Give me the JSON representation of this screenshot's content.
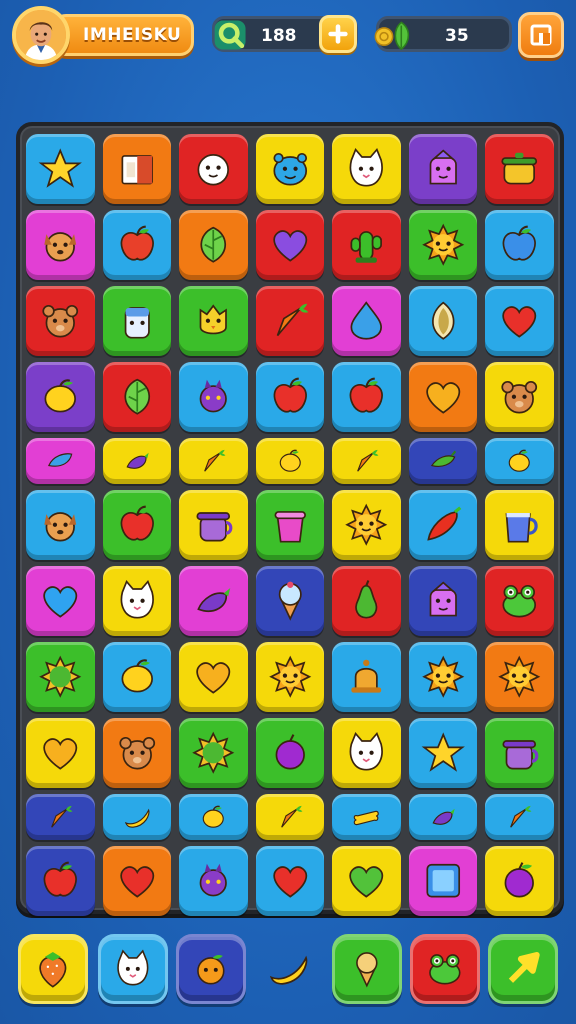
{
  "player": {
    "name": "IMHEISKU",
    "avatar_icon": "boy-portrait-icon"
  },
  "resources": {
    "gems": {
      "value": "188",
      "icon": "green-key-icon",
      "action_icon": "plus-icon"
    },
    "coins": {
      "value": "35",
      "icon": "coin-leaf-icon"
    }
  },
  "menu": {
    "icon": "menu-box-icon"
  },
  "colors": {
    "yellow": "#f5d90a",
    "orange": "#f27a13",
    "red": "#e02424",
    "blue": "#2aa9e8",
    "purple": "#7b3fc9",
    "pink": "#e23fd4",
    "green": "#3cbf2a",
    "navy": "#3346b8",
    "board": "#3a3d42",
    "background": "#1d63b8"
  },
  "board": {
    "columns": 7,
    "rows": [
      {
        "tiles": [
          {
            "bg": "blue",
            "icon": "star"
          },
          {
            "bg": "orange",
            "icon": "box"
          },
          {
            "bg": "red",
            "icon": "cup-face"
          },
          {
            "bg": "yellow",
            "icon": "blue-creature"
          },
          {
            "bg": "yellow",
            "icon": "cat"
          },
          {
            "bg": "purple",
            "icon": "ghost"
          },
          {
            "bg": "red",
            "icon": "pot"
          }
        ]
      },
      {
        "tiles": [
          {
            "bg": "pink",
            "icon": "dog"
          },
          {
            "bg": "blue",
            "icon": "apple"
          },
          {
            "bg": "orange",
            "icon": "leaf"
          },
          {
            "bg": "red",
            "icon": "purple-heart"
          },
          {
            "bg": "red",
            "icon": "cactus"
          },
          {
            "bg": "green",
            "icon": "sun"
          },
          {
            "bg": "blue",
            "icon": "blue-apple"
          }
        ]
      },
      {
        "tiles": [
          {
            "bg": "red",
            "icon": "bear"
          },
          {
            "bg": "green",
            "icon": "jar"
          },
          {
            "bg": "green",
            "icon": "owl"
          },
          {
            "bg": "red",
            "icon": "carrot"
          },
          {
            "bg": "pink",
            "icon": "drop"
          },
          {
            "bg": "blue",
            "icon": "seed"
          },
          {
            "bg": "blue",
            "icon": "heart"
          }
        ]
      },
      {
        "tiles": [
          {
            "bg": "purple",
            "icon": "lemon"
          },
          {
            "bg": "red",
            "icon": "leaf"
          },
          {
            "bg": "blue",
            "icon": "bat"
          },
          {
            "bg": "blue",
            "icon": "red-apple"
          },
          {
            "bg": "blue",
            "icon": "red-apple"
          },
          {
            "bg": "orange",
            "icon": "gold-heart"
          },
          {
            "bg": "yellow",
            "icon": "bear"
          }
        ]
      },
      {
        "short": true,
        "tiles": [
          {
            "bg": "pink",
            "icon": "blue-fish"
          },
          {
            "bg": "yellow",
            "icon": "eggplant"
          },
          {
            "bg": "yellow",
            "icon": "carrot"
          },
          {
            "bg": "yellow",
            "icon": "lemon"
          },
          {
            "bg": "yellow",
            "icon": "carrot"
          },
          {
            "bg": "navy",
            "icon": "pickle"
          },
          {
            "bg": "blue",
            "icon": "lemon"
          }
        ]
      },
      {
        "tiles": [
          {
            "bg": "blue",
            "icon": "dog"
          },
          {
            "bg": "green",
            "icon": "red-apple"
          },
          {
            "bg": "yellow",
            "icon": "pot-purple"
          },
          {
            "bg": "green",
            "icon": "bucket"
          },
          {
            "bg": "yellow",
            "icon": "sun"
          },
          {
            "bg": "blue",
            "icon": "chili"
          },
          {
            "bg": "yellow",
            "icon": "mug"
          }
        ]
      },
      {
        "tiles": [
          {
            "bg": "pink",
            "icon": "blue-heart"
          },
          {
            "bg": "yellow",
            "icon": "cat"
          },
          {
            "bg": "pink",
            "icon": "eggplant"
          },
          {
            "bg": "navy",
            "icon": "icecream"
          },
          {
            "bg": "red",
            "icon": "pear"
          },
          {
            "bg": "navy",
            "icon": "ghost"
          },
          {
            "bg": "red",
            "icon": "frog"
          }
        ]
      },
      {
        "tiles": [
          {
            "bg": "green",
            "icon": "sun-green"
          },
          {
            "bg": "blue",
            "icon": "lemon"
          },
          {
            "bg": "yellow",
            "icon": "gold-heart"
          },
          {
            "bg": "yellow",
            "icon": "sun"
          },
          {
            "bg": "blue",
            "icon": "bell"
          },
          {
            "bg": "blue",
            "icon": "sun"
          },
          {
            "bg": "orange",
            "icon": "sun"
          }
        ]
      },
      {
        "tiles": [
          {
            "bg": "yellow",
            "icon": "gold-heart"
          },
          {
            "bg": "orange",
            "icon": "bear"
          },
          {
            "bg": "green",
            "icon": "sun-green"
          },
          {
            "bg": "green",
            "icon": "plum"
          },
          {
            "bg": "yellow",
            "icon": "cat"
          },
          {
            "bg": "blue",
            "icon": "star"
          },
          {
            "bg": "green",
            "icon": "pot-purple"
          }
        ]
      },
      {
        "short": true,
        "tiles": [
          {
            "bg": "navy",
            "icon": "carrot"
          },
          {
            "bg": "blue",
            "icon": "banana"
          },
          {
            "bg": "blue",
            "icon": "lemon"
          },
          {
            "bg": "yellow",
            "icon": "carrot"
          },
          {
            "bg": "blue",
            "icon": "bone"
          },
          {
            "bg": "blue",
            "icon": "eggplant"
          },
          {
            "bg": "blue",
            "icon": "carrot"
          }
        ]
      },
      {
        "tiles": [
          {
            "bg": "navy",
            "icon": "red-apple"
          },
          {
            "bg": "orange",
            "icon": "red-heart"
          },
          {
            "bg": "blue",
            "icon": "bat"
          },
          {
            "bg": "blue",
            "icon": "red-heart"
          },
          {
            "bg": "yellow",
            "icon": "green-heart"
          },
          {
            "bg": "pink",
            "icon": "gem-box"
          },
          {
            "bg": "yellow",
            "icon": "plum"
          }
        ]
      }
    ]
  },
  "dock": {
    "buttons": [
      {
        "bg": "yellow",
        "icon": "strawberry",
        "name": "dock-strawberry-button"
      },
      {
        "bg": "blue",
        "icon": "cat",
        "name": "dock-cat-button"
      },
      {
        "bg": "navy",
        "icon": "orange-fruit",
        "name": "dock-orange-button"
      },
      {
        "bg": "none",
        "icon": "banana",
        "name": "dock-banana-button"
      },
      {
        "bg": "green",
        "icon": "cone",
        "name": "dock-cone-button"
      },
      {
        "bg": "red",
        "icon": "frog",
        "name": "dock-frog-button"
      },
      {
        "bg": "green",
        "icon": "arrow",
        "name": "dock-next-button"
      }
    ]
  }
}
